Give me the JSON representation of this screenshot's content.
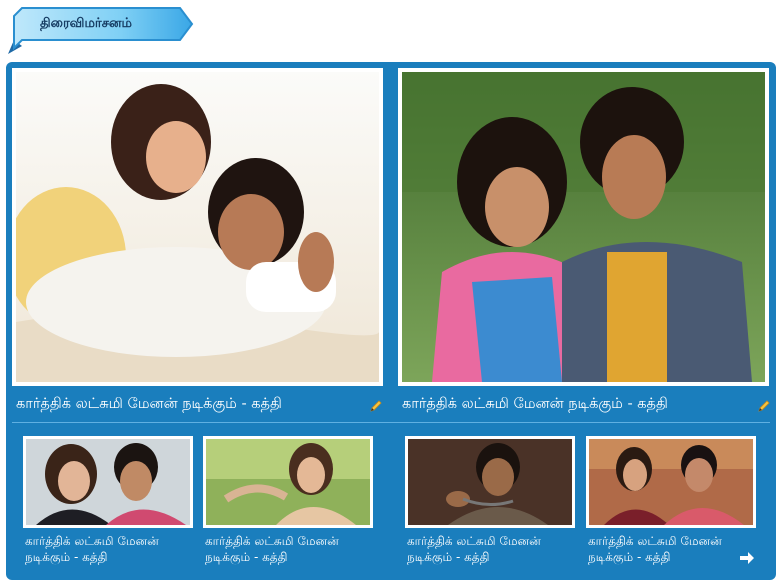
{
  "section": {
    "title": "திரைவிமர்சனம்"
  },
  "featured": [
    {
      "caption": "கார்த்திக் லட்சுமி மேனன் நடிக்கும் - கத்தி"
    },
    {
      "caption": "கார்த்திக் லட்சுமி மேனன் நடிக்கும் - கத்தி"
    }
  ],
  "thumbs": [
    {
      "caption": "கார்த்திக் லட்சுமி மேனன் நடிக்கும் - கத்தி"
    },
    {
      "caption": "கார்த்திக் லட்சுமி மேனன் நடிக்கும் - கத்தி"
    },
    {
      "caption": "கார்த்திக் லட்சுமி மேனன் நடிக்கும் - கத்தி"
    },
    {
      "caption": "கார்த்திக் லட்சுமி மேனன் நடிக்கும் - கத்தி"
    }
  ],
  "colors": {
    "panel": "#1a7ebd",
    "header_blue": "#2a8fd0",
    "header_text": "#163c63"
  },
  "icons": {
    "edit": "pencil-icon",
    "more": "arrow-right-icon"
  }
}
